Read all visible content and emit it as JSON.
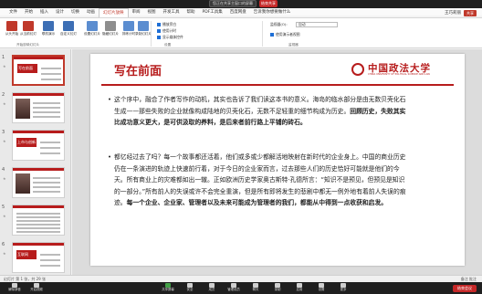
{
  "meeting": {
    "share_banner": "您正在共享主窗口的屏幕",
    "stop_share": "结束共享",
    "mute_label": "解除静音",
    "video_label": "开启视频",
    "end_label": "结束会议",
    "toolbar": [
      {
        "name": "share-screen",
        "label": "共享屏幕"
      },
      {
        "name": "security",
        "label": "安全"
      },
      {
        "name": "participants",
        "label": "成员"
      },
      {
        "name": "manage-members",
        "label": "管理成员"
      },
      {
        "name": "chat",
        "label": "聊天"
      },
      {
        "name": "record",
        "label": "录制"
      },
      {
        "name": "apps",
        "label": "应用"
      },
      {
        "name": "settings",
        "label": "设置"
      },
      {
        "name": "more",
        "label": "更多"
      }
    ]
  },
  "ppt": {
    "tabs": [
      "文件",
      "开始",
      "插入",
      "设计",
      "切换",
      "动画",
      "幻灯片放映",
      "审阅",
      "视图",
      "开发工具",
      "帮助",
      "PDF工具集",
      "百度网盘",
      "告诉我你想要做什么"
    ],
    "active_tab_index": 6,
    "user_name": "王巧莉丽",
    "share_label": "共享",
    "ribbon": {
      "buttons": [
        {
          "label": "从头开始",
          "color": "#c0392b"
        },
        {
          "label": "从当前幻灯片开始",
          "color": "#c0392b"
        },
        {
          "label": "联机演示",
          "color": "#3d6fb5"
        },
        {
          "label": "自定义幻灯片放映",
          "color": "#3d6fb5"
        },
        {
          "label": "设置幻灯片放映",
          "color": "#5b8dd0"
        },
        {
          "label": "隐藏幻灯片",
          "color": "#8e8e8e"
        },
        {
          "label": "排练计时",
          "color": "#5b8dd0"
        },
        {
          "label": "录制幻灯片演示",
          "color": "#5b8dd0"
        }
      ],
      "checks": [
        {
          "label": "播放旁白",
          "on": true
        },
        {
          "label": "使用计时",
          "on": true
        },
        {
          "label": "显示媒体控件",
          "on": true
        }
      ],
      "monitor_label": "监视器(O):",
      "monitor_value": "自动",
      "presenter_view": "使用演示者视图",
      "groups": [
        "开始放映幻灯片",
        "设置",
        "监视器"
      ]
    },
    "thumbnails": [
      {
        "num": "1",
        "text": "写在前面",
        "selected": true
      },
      {
        "num": "2",
        "text": "",
        "selected": false
      },
      {
        "num": "3",
        "text": "上市与创新",
        "selected": false
      },
      {
        "num": "4",
        "text": "",
        "selected": false
      },
      {
        "num": "5",
        "text": "",
        "selected": false
      },
      {
        "num": "6",
        "text": "互联网",
        "selected": false
      }
    ],
    "slide": {
      "title": "写在前面",
      "logo_name": "中国政法大学",
      "logo_en": "CHINA UNIVERSITY OF POLITICAL SCIENCE AND LAW",
      "bullet1": {
        "text": "这个序中，融合了作者写作的动机，其实也告诉了我们读这本书的意义。海岛的临水部分是由无数贝壳化石生成——那些失败的企业就像构成陆地的贝壳化石，无数不足轻重的细节构成为历史。",
        "bold": "回顾历史，失败其实比成功意义更大，是可供汲取的养料，是后来者前行路上平铺的砖石。"
      },
      "bullet2": {
        "text": "都亿经过去了吗？每一个故事都还活着，他们或多或少都解活地映射在新时代的企业身上。中国的商业历史仍在一条演进的轨迹上快速前行着，对于今日的企业家而言，过去那些人们的历史恰好可能就是他们的今天。所有商业上的灾难都如出一辙。正如欧洲历史学家奥古斯特·孔德所言：“知识不是预见，但预见是知识的一部分。”所有前人的失误或许不会完全重演，但是所有即将发生的悲剧中都无一例外地有着前人失误的痕迹。",
        "bold": "每一个企业、企业家、管理者以及未来可能成为管理者的我们，都能从中得到一点收获和启发。"
      }
    },
    "status_left": "幻灯片 第 1 张，共 29 张",
    "status_right": "备注 批注"
  }
}
